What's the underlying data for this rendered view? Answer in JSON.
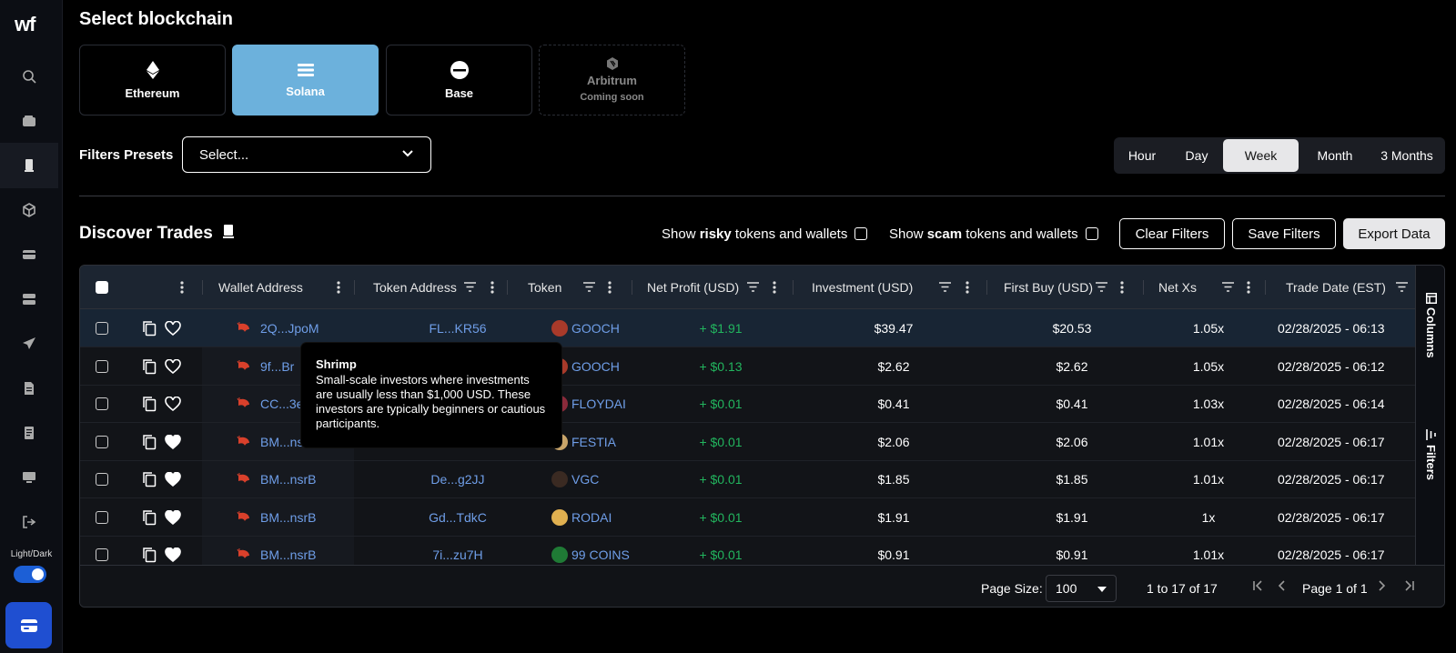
{
  "logo": "wf",
  "sidebar": {
    "icons": [
      "search-icon",
      "wallet-icon",
      "phone-icon",
      "cube-icon",
      "card-icon",
      "stack-icon",
      "send-icon",
      "document-icon",
      "receipt-icon",
      "monitor-icon",
      "logout-icon"
    ],
    "toggle_label": "Light/Dark"
  },
  "page": {
    "title": "Select blockchain",
    "chains": [
      {
        "name": "Ethereum",
        "sub": ""
      },
      {
        "name": "Solana",
        "sub": ""
      },
      {
        "name": "Base",
        "sub": ""
      },
      {
        "name": "Arbitrum",
        "sub": "Coming soon"
      }
    ],
    "filters_label": "Filters Presets",
    "filters_placeholder": "Select...",
    "ranges": [
      "Hour",
      "Day",
      "Week",
      "Month",
      "3 Months"
    ],
    "active_range": "Week"
  },
  "discover": {
    "title": "Discover Trades",
    "risky_prefix": "Show ",
    "risky_bold": "risky",
    "risky_suffix": " tokens and wallets",
    "scam_prefix": "Show ",
    "scam_bold": "scam",
    "scam_suffix": " tokens and wallets",
    "clear": "Clear Filters",
    "save": "Save Filters",
    "export": "Export Data"
  },
  "table": {
    "columns": [
      "Wallet Address",
      "Token Address",
      "Token",
      "Net Profit (USD)",
      "Investment (USD)",
      "First Buy (USD)",
      "Net Xs",
      "Trade Date (EST)"
    ],
    "rows": [
      {
        "wallet": "2Q...JpoM",
        "token_addr": "FL...KR56",
        "token": "GOOCH",
        "profit": "+ $1.91",
        "invest": "$39.47",
        "first": "$20.53",
        "xs": "1.05x",
        "date": "02/28/2025 - 06:13",
        "fav": false
      },
      {
        "wallet": "9f...Br",
        "token_addr": "",
        "token": "GOOCH",
        "profit": "+ $0.13",
        "invest": "$2.62",
        "first": "$2.62",
        "xs": "1.05x",
        "date": "02/28/2025 - 06:12",
        "fav": false
      },
      {
        "wallet": "CC...3e",
        "token_addr": "",
        "token": "FLOYDAI",
        "profit": "+ $0.01",
        "invest": "$0.41",
        "first": "$0.41",
        "xs": "1.03x",
        "date": "02/28/2025 - 06:14",
        "fav": false
      },
      {
        "wallet": "BM...ns",
        "token_addr": "",
        "token": "FESTIA",
        "profit": "+ $0.01",
        "invest": "$2.06",
        "first": "$2.06",
        "xs": "1.01x",
        "date": "02/28/2025 - 06:17",
        "fav": true
      },
      {
        "wallet": "BM...nsrB",
        "token_addr": "De...g2JJ",
        "token": "VGC",
        "profit": "+ $0.01",
        "invest": "$1.85",
        "first": "$1.85",
        "xs": "1.01x",
        "date": "02/28/2025 - 06:17",
        "fav": true
      },
      {
        "wallet": "BM...nsrB",
        "token_addr": "Gd...TdkC",
        "token": "RODAI",
        "profit": "+ $0.01",
        "invest": "$1.91",
        "first": "$1.91",
        "xs": "1x",
        "date": "02/28/2025 - 06:17",
        "fav": true
      },
      {
        "wallet": "BM...nsrB",
        "token_addr": "7i...zu7H",
        "token": "99 COINS",
        "profit": "+ $0.01",
        "invest": "$0.91",
        "first": "$0.91",
        "xs": "1.01x",
        "date": "02/28/2025 - 06:17",
        "fav": true
      }
    ],
    "side_columns": "Columns",
    "side_filters": "Filters",
    "page_size_label": "Page Size:",
    "page_size": "100",
    "range_text": "1 to 17 of 17",
    "page_text": "Page 1 of 1"
  },
  "tooltip": {
    "title": "Shrimp",
    "body": "Small-scale investors where investments are usually less than $1,000 USD. These investors are typically beginners or cautious participants."
  },
  "colors": {
    "accent": "#6cb1dc",
    "link": "#6f9ee8",
    "positive": "#22b55e",
    "toggle": "#1c5fd6"
  }
}
